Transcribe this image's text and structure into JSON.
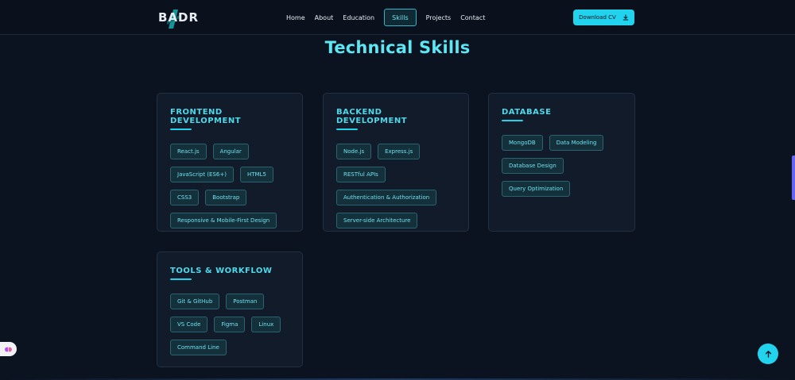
{
  "brand": {
    "logo_text": "BADR"
  },
  "nav": {
    "links": [
      {
        "label": "Home"
      },
      {
        "label": "About"
      },
      {
        "label": "Education"
      },
      {
        "label": "Skills",
        "active": true
      },
      {
        "label": "Projects"
      },
      {
        "label": "Contact"
      }
    ],
    "cv_button_label": "Download CV",
    "cv_icon": "download-icon"
  },
  "page": {
    "title": "Technical Skills"
  },
  "sections": [
    {
      "title": "FRONTEND DEVELOPMENT",
      "skills": [
        "React.js",
        "Angular",
        "JavaScript (ES6+)",
        "HTML5",
        "CSS3",
        "Bootstrap",
        "Responsive & Mobile-First Design"
      ]
    },
    {
      "title": "BACKEND DEVELOPMENT",
      "skills": [
        "Node.js",
        "Express.js",
        "RESTful APIs",
        "Authentication & Authorization",
        "Server-side Architecture"
      ]
    },
    {
      "title": "DATABASE",
      "skills": [
        "MongoDB",
        "Data Modeling",
        "Database Design",
        "Query Optimization"
      ]
    },
    {
      "title": "TOOLS & WORKFLOW",
      "skills": [
        "Git & GitHub",
        "Postman",
        "VS Code",
        "Figma",
        "Linux",
        "Command Line"
      ]
    }
  ],
  "controls": {
    "scroll_top_icon": "arrow-up-icon",
    "side_widget_icon": "brain-icon"
  },
  "colors": {
    "accent": "#22d3ee",
    "background": "#0b1220",
    "card": "#121b29"
  }
}
